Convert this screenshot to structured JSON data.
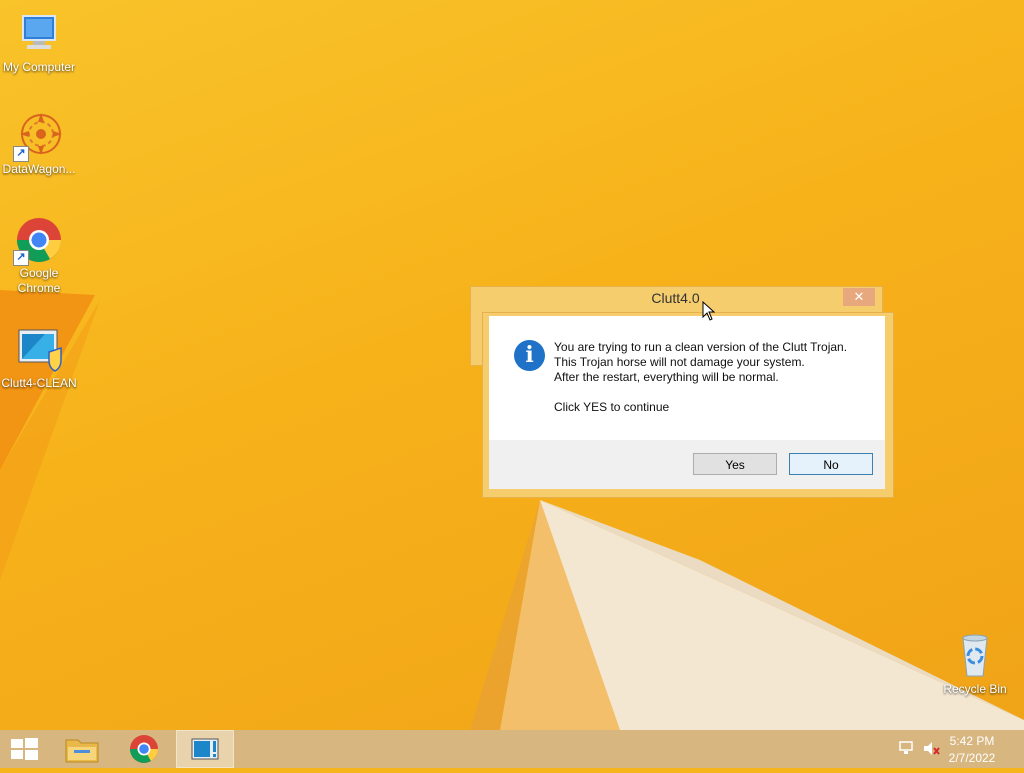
{
  "desktop": {
    "icons": [
      {
        "label": "My Computer"
      },
      {
        "label": "DataWagon..."
      },
      {
        "label": "Google Chrome"
      },
      {
        "label": "Clutt4-CLEAN"
      },
      {
        "label": "Recycle Bin"
      }
    ]
  },
  "dialog": {
    "title": "Clutt4.0",
    "close_label": "✕",
    "message_lines": [
      "You are trying to run a clean version of the Clutt Trojan.",
      "This Trojan horse will not damage your system.",
      "After the restart, everything will be normal.",
      "Click YES to continue"
    ],
    "yes_label": "Yes",
    "no_label": "No",
    "icon": "info-icon"
  },
  "taskbar": {
    "items": [
      "start-icon",
      "file-explorer-icon",
      "chrome-icon",
      "clutt-app-icon"
    ],
    "time": "5:42 PM",
    "date": "2/7/2022"
  },
  "colors": {
    "wallpaper": "#f7b51c",
    "taskbar": "#d7b680",
    "dialog_accent": "#f6cd6d"
  }
}
